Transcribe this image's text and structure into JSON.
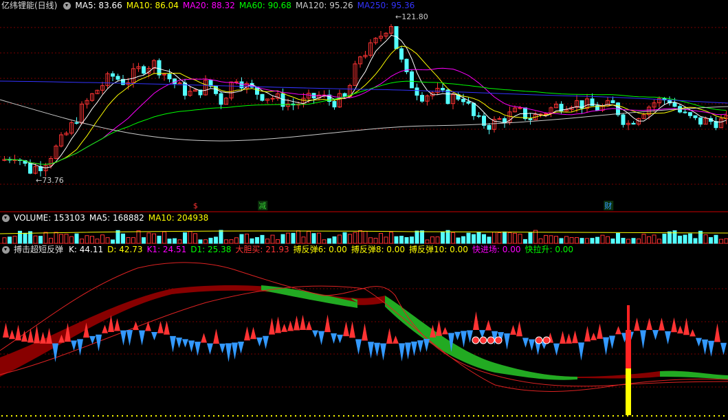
{
  "price_panel": {
    "title": "亿纬锂能(日线)",
    "ma": [
      {
        "label": "MA5: 83.66",
        "color": "#ffffff"
      },
      {
        "label": "MA10: 86.04",
        "color": "#ffff00"
      },
      {
        "label": "MA20: 88.32",
        "color": "#ff00ff"
      },
      {
        "label": "MA60: 90.68",
        "color": "#00ff00"
      },
      {
        "label": "MA120: 95.26",
        "color": "#cccccc"
      },
      {
        "label": "MA250: 95.36",
        "color": "#3333ff"
      }
    ],
    "high_label": "121.80",
    "low_label": "73.76",
    "markers": [
      {
        "text": "$",
        "color": "#ff3333",
        "at": 0.27
      },
      {
        "text": "减",
        "color": "#33cc33",
        "at": 0.36
      },
      {
        "text": "财",
        "color": "#3399ff",
        "at": 0.835
      }
    ]
  },
  "volume_panel": {
    "items": [
      {
        "label": "VOLUME: 153103",
        "color": "#ffffff"
      },
      {
        "label": "MA5: 168882",
        "color": "#ffffff"
      },
      {
        "label": "MA10: 204938",
        "color": "#ffff00"
      }
    ]
  },
  "indicator_panel": {
    "name": "搏击超短反弹",
    "items": [
      {
        "label": "K: 44.11",
        "color": "#ffffff"
      },
      {
        "label": "D: 42.73",
        "color": "#ffff00"
      },
      {
        "label": "K1: 24.51",
        "color": "#ff00ff"
      },
      {
        "label": "D1: 25.38",
        "color": "#00ff00"
      },
      {
        "label": "大胆买: 21.93",
        "color": "#ff3333"
      },
      {
        "label": "搏反弹6: 0.00",
        "color": "#ffff00"
      },
      {
        "label": "搏反弹8: 0.00",
        "color": "#ffff00"
      },
      {
        "label": "搏反弹10: 0.00",
        "color": "#ffff00"
      },
      {
        "label": "快进场: 0.00",
        "color": "#ff00ff"
      },
      {
        "label": "快拉升: 0.00",
        "color": "#00ff00"
      }
    ]
  },
  "colors": {
    "up": "#ff3333",
    "down": "#54ffff",
    "grid": "#7a0000",
    "separator": "#cc0000"
  }
}
